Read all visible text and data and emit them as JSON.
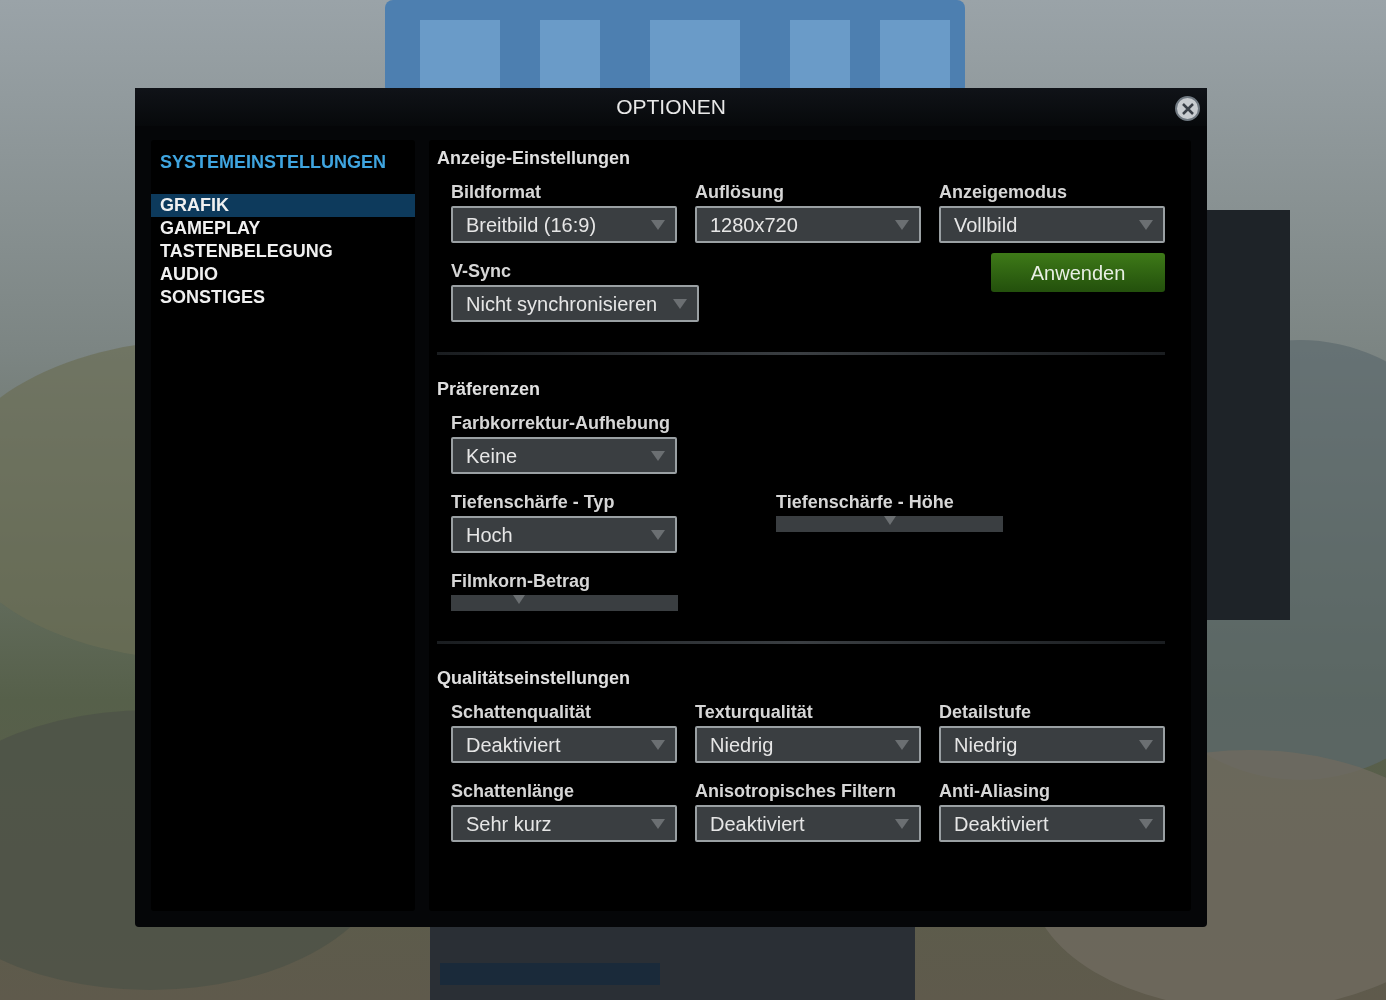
{
  "window": {
    "title": "OPTIONEN"
  },
  "sidebar": {
    "heading": "SYSTEMEINSTELLUNGEN",
    "items": [
      {
        "label": "GRAFIK",
        "selected": true
      },
      {
        "label": "GAMEPLAY",
        "selected": false
      },
      {
        "label": "TASTENBELEGUNG",
        "selected": false
      },
      {
        "label": "AUDIO",
        "selected": false
      },
      {
        "label": "SONSTIGES",
        "selected": false
      }
    ]
  },
  "sections": [
    {
      "title": "Anzeige-Einstellungen",
      "rows": [
        {
          "kind": "grid",
          "controls": [
            {
              "kind": "dropdown",
              "label": "Bildformat",
              "value": "Breitbild (16:9)"
            },
            {
              "kind": "dropdown",
              "label": "Auflösung",
              "value": "1280x720"
            },
            {
              "kind": "dropdown",
              "label": "Anzeigemodus",
              "value": "Vollbild"
            }
          ]
        },
        {
          "kind": "grid",
          "controls": [
            {
              "kind": "dropdown",
              "label": "V-Sync",
              "value": "Nicht synchronisieren"
            },
            {
              "kind": "button",
              "label": "Anwenden"
            }
          ]
        }
      ]
    },
    {
      "title": "Präferenzen",
      "rows": [
        {
          "kind": "grid",
          "controls": [
            {
              "kind": "dropdown",
              "label": "Farbkorrektur-Aufhebung",
              "value": "Keine"
            }
          ]
        },
        {
          "kind": "spread",
          "controls": [
            {
              "kind": "dropdown",
              "label": "Tiefenschärfe - Typ",
              "value": "Hoch"
            },
            {
              "kind": "slider",
              "label": "Tiefenschärfe - Höhe",
              "level": 0.5
            }
          ]
        },
        {
          "kind": "grid",
          "controls": [
            {
              "kind": "slider",
              "label": "Filmkorn-Betrag",
              "level": 0.3
            }
          ]
        }
      ]
    },
    {
      "title": "Qualitätseinstellungen",
      "rows": [
        {
          "kind": "grid",
          "controls": [
            {
              "kind": "dropdown",
              "label": "Schattenqualität",
              "value": "Deaktiviert"
            },
            {
              "kind": "dropdown",
              "label": "Texturqualität",
              "value": "Niedrig"
            },
            {
              "kind": "dropdown",
              "label": "Detailstufe",
              "value": "Niedrig"
            }
          ]
        },
        {
          "kind": "grid",
          "controls": [
            {
              "kind": "dropdown",
              "label": "Schattenlänge",
              "value": "Sehr kurz"
            },
            {
              "kind": "dropdown",
              "label": "Anisotropisches Filtern",
              "value": "Deaktiviert"
            },
            {
              "kind": "dropdown",
              "label": "Anti-Aliasing",
              "value": "Deaktiviert"
            }
          ]
        }
      ]
    }
  ]
}
